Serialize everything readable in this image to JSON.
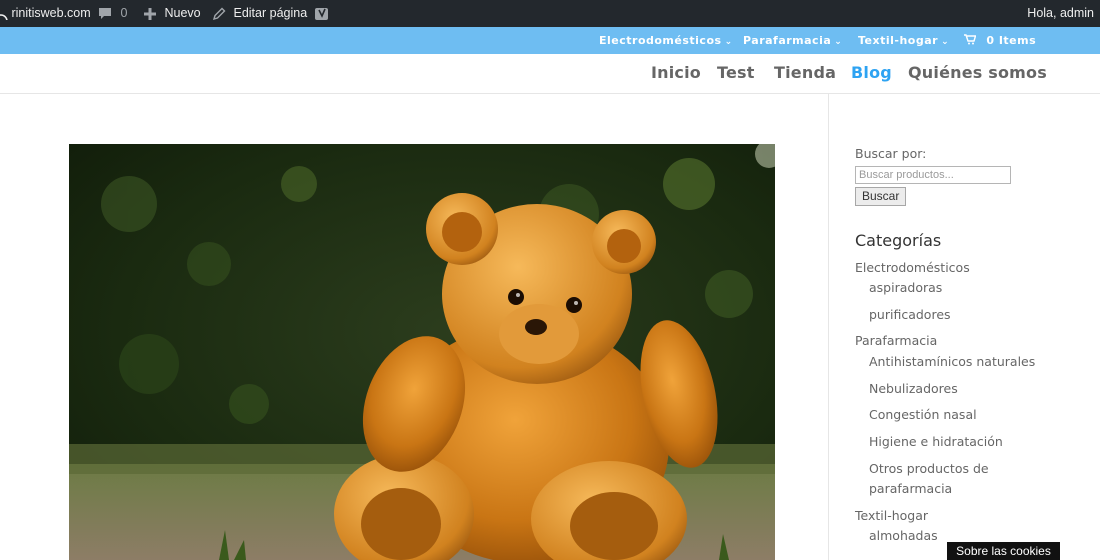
{
  "adminbar": {
    "site_name": "rinitisweb.com",
    "comments_count": "0",
    "new_label": "Nuevo",
    "edit_label": "Editar página",
    "greeting": "Hola, admin"
  },
  "topbar": {
    "items": [
      {
        "label": "Electrodomésticos"
      },
      {
        "label": "Parafarmacia"
      },
      {
        "label": "Textil-hogar"
      }
    ],
    "cart_label": "0 Items"
  },
  "nav": {
    "items": [
      {
        "label": "Inicio"
      },
      {
        "label": "Test"
      },
      {
        "label": "Tienda"
      },
      {
        "label": "Blog"
      },
      {
        "label": "Quiénes somos"
      }
    ],
    "active": "Blog"
  },
  "sidebar": {
    "search_label": "Buscar por:",
    "search_placeholder": "Buscar productos...",
    "search_button": "Buscar",
    "categories_title": "Categorías",
    "categories": [
      "Electrodomésticos",
      "aspiradoras",
      "purificadores",
      "Parafarmacia",
      "Antihistamínicos naturales",
      "Nebulizadores",
      "Congestión nasal",
      "Higiene e hidratación",
      "Otros productos de",
      "parafarmacia",
      "Textil-hogar",
      "almohadas"
    ]
  },
  "cookie_label": "Sobre las cookies",
  "colors": {
    "adminbar_bg": "#23282d",
    "topbar_bg": "#6ebdf2",
    "nav_active": "#2ea3f2",
    "nav_text": "#666666"
  },
  "icons": [
    "wordpress-icon",
    "comment-icon",
    "plus-icon",
    "pencil-icon",
    "yoast-icon",
    "chevron-down-icon",
    "cart-icon"
  ]
}
